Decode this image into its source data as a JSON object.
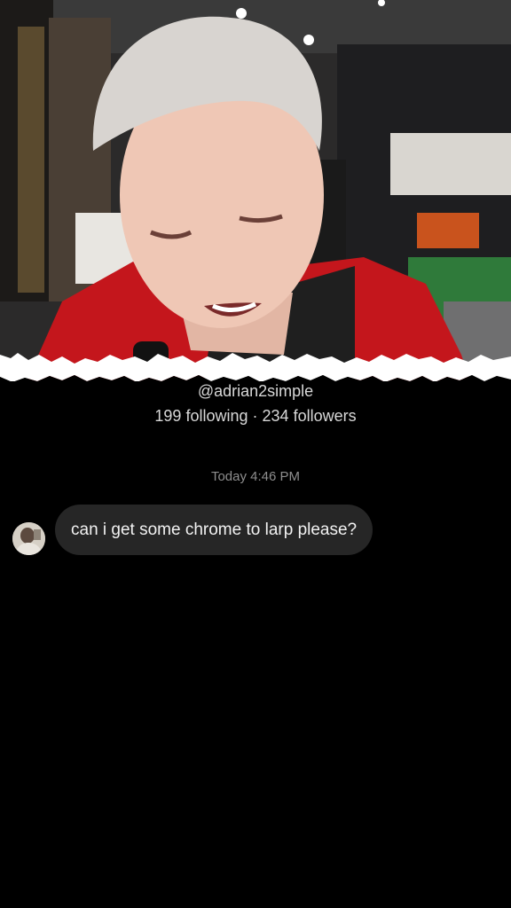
{
  "profile": {
    "handle": "@adrian2simple",
    "following_count": "199",
    "following_label": "following",
    "separator": "·",
    "followers_count": "234",
    "followers_label": "followers"
  },
  "conversation": {
    "timestamp": "Today 4:46 PM",
    "messages": [
      {
        "sender": "other",
        "avatar_icon": "user-avatar-icon",
        "text": "can i get some chrome to larp please?"
      }
    ]
  },
  "colors": {
    "background": "#000000",
    "bubble": "#262626",
    "primary_text": "#f2f2f2",
    "secondary_text": "#8e8e8e"
  }
}
